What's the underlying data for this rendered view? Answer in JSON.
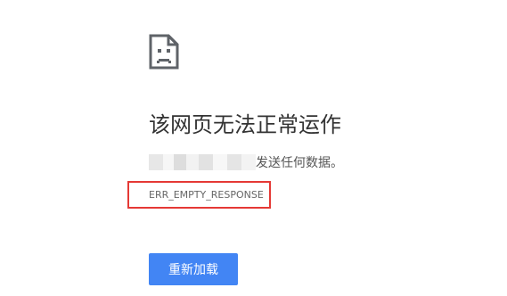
{
  "error_page": {
    "icon": "sad-document-icon",
    "title": "该网页无法正常运作",
    "description_suffix": "发送任何数据。",
    "error_code": "ERR_EMPTY_RESPONSE",
    "reload_label": "重新加载"
  },
  "colors": {
    "accent": "#4285f4",
    "highlight_box": "#e53935",
    "title_text": "#333333"
  }
}
